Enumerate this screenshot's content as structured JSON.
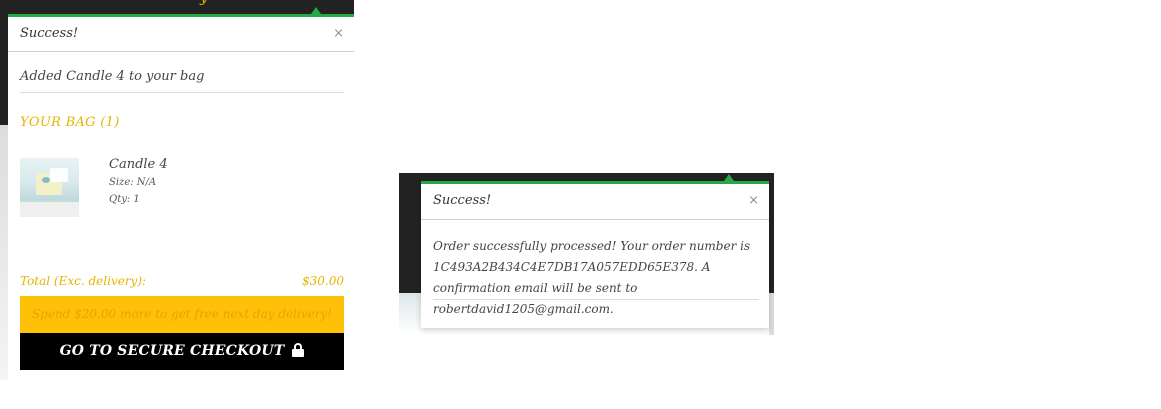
{
  "left_toast": {
    "title": "Success!",
    "close_label": "×",
    "message": "Added Candle 4 to your bag",
    "peek_text": "y",
    "bag": {
      "heading": "YOUR BAG (1)",
      "items": [
        {
          "name": "Candle 4",
          "size": "Size: N/A",
          "qty": "Qty: 1"
        }
      ],
      "total_label": "Total (Exc. delivery):",
      "total_value": "$30.00",
      "promo_text": "Spend $20.00 more to get free next day delivery!",
      "checkout_label": "GO TO SECURE CHECKOUT"
    }
  },
  "right_toast": {
    "title": "Success!",
    "close_label": "×",
    "message": "Order successfully processed! Your order number is 1C493A2B434C4E7DB17A057EDD65E378. A confirmation email will be sent to robertdavid1205@gmail.com."
  },
  "colors": {
    "accent_gold": "#e6b400",
    "promo_yellow": "#ffc107",
    "success_green": "#27a745",
    "checkout_black": "#000000",
    "dark_background": "#222222"
  },
  "icons": {
    "close": "close-icon",
    "lock": "lock-icon",
    "arrow": "caret-up-icon"
  }
}
